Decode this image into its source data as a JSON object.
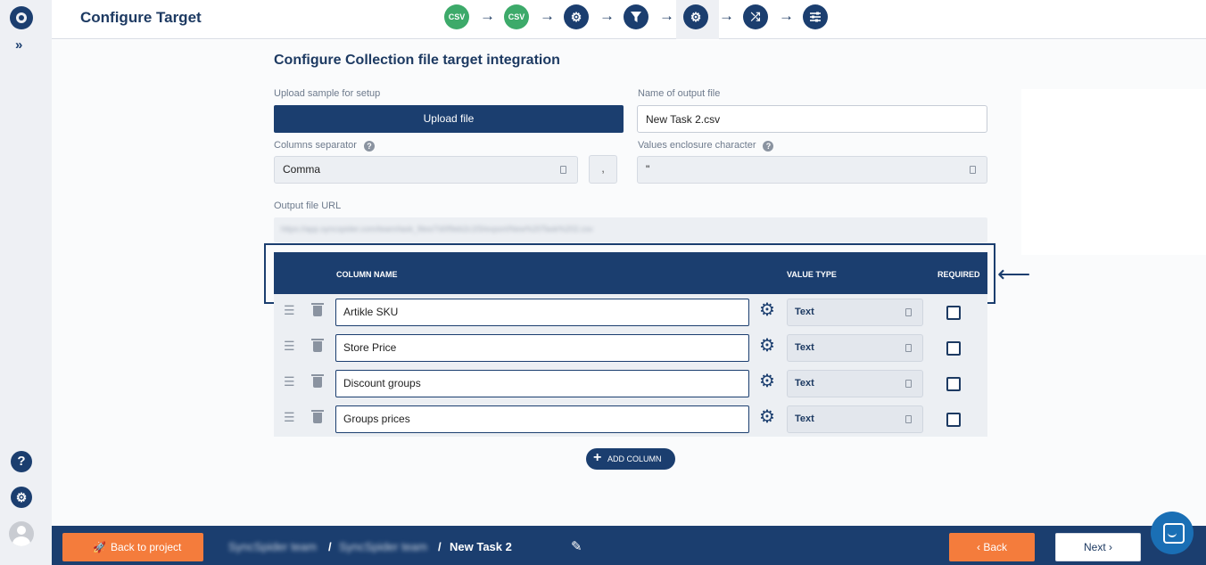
{
  "header": {
    "title": "Configure Target",
    "steps": [
      {
        "label": "CSV",
        "icon": "csv-icon",
        "state": "done"
      },
      {
        "label": "CSV",
        "icon": "csv-icon",
        "state": "done"
      },
      {
        "label": "",
        "icon": "gear-icon",
        "state": "pending"
      },
      {
        "label": "",
        "icon": "filter-icon",
        "state": "pending"
      },
      {
        "label": "",
        "icon": "gear-icon",
        "state": "active"
      },
      {
        "label": "",
        "icon": "shuffle-icon",
        "state": "pending"
      },
      {
        "label": "",
        "icon": "sliders-icon",
        "state": "pending"
      }
    ]
  },
  "sidebar": {
    "expand": "»",
    "help": "?",
    "settings": "⚙"
  },
  "form": {
    "subtitle": "Configure Collection file target integration",
    "upload_label": "Upload sample for setup",
    "upload_button": "Upload file",
    "output_name_label": "Name of output file",
    "output_name_value": "New Task 2.csv",
    "separator_label": "Columns separator",
    "separator_value": "Comma",
    "separator_char": ",",
    "enclosure_label": "Values enclosure character",
    "enclosure_value": "\"",
    "url_label": "Output file URL",
    "url_value": "https://app.syncspider.com/team/task_files/7d0f9eb2c1f3/export/New%20Task%202.csv"
  },
  "table": {
    "headers": {
      "name": "COLUMN NAME",
      "type": "VALUE TYPE",
      "required": "REQUIRED"
    },
    "rows": [
      {
        "name": "Artikle SKU",
        "type": "Text",
        "required": false
      },
      {
        "name": "Store Price",
        "type": "Text",
        "required": false
      },
      {
        "name": "Discount groups",
        "type": "Text",
        "required": false
      },
      {
        "name": "Groups prices",
        "type": "Text",
        "required": false
      }
    ],
    "add_button": "ADD COLUMN"
  },
  "annotation": {
    "arrow": "⟵"
  },
  "footer": {
    "back_to_project": "Back to project",
    "breadcrumb": [
      "SyncSpider team",
      "SyncSpider team",
      "New Task 2"
    ],
    "separator": "/",
    "back": "Back",
    "next": "Next"
  },
  "colors": {
    "primary": "#1b3e6f",
    "accent": "#f47c3c",
    "success": "#3daa6a",
    "chat": "#1a6fb5"
  }
}
